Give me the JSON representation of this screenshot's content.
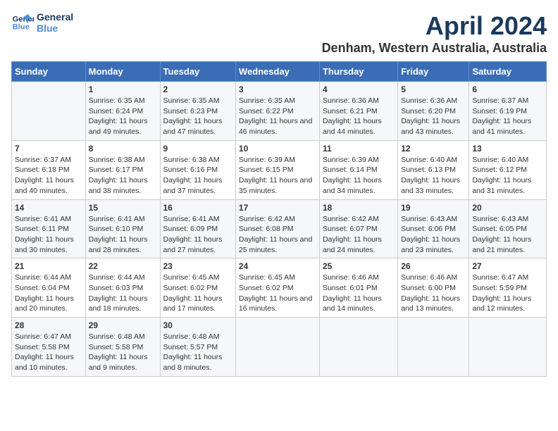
{
  "logo": {
    "line1": "General",
    "line2": "Blue"
  },
  "title": "April 2024",
  "subtitle": "Denham, Western Australia, Australia",
  "columns": [
    "Sunday",
    "Monday",
    "Tuesday",
    "Wednesday",
    "Thursday",
    "Friday",
    "Saturday"
  ],
  "weeks": [
    [
      {
        "day": "",
        "sunrise": "",
        "sunset": "",
        "daylight": ""
      },
      {
        "day": "1",
        "sunrise": "Sunrise: 6:35 AM",
        "sunset": "Sunset: 6:24 PM",
        "daylight": "Daylight: 11 hours and 49 minutes."
      },
      {
        "day": "2",
        "sunrise": "Sunrise: 6:35 AM",
        "sunset": "Sunset: 6:23 PM",
        "daylight": "Daylight: 11 hours and 47 minutes."
      },
      {
        "day": "3",
        "sunrise": "Sunrise: 6:35 AM",
        "sunset": "Sunset: 6:22 PM",
        "daylight": "Daylight: 11 hours and 46 minutes."
      },
      {
        "day": "4",
        "sunrise": "Sunrise: 6:36 AM",
        "sunset": "Sunset: 6:21 PM",
        "daylight": "Daylight: 11 hours and 44 minutes."
      },
      {
        "day": "5",
        "sunrise": "Sunrise: 6:36 AM",
        "sunset": "Sunset: 6:20 PM",
        "daylight": "Daylight: 11 hours and 43 minutes."
      },
      {
        "day": "6",
        "sunrise": "Sunrise: 6:37 AM",
        "sunset": "Sunset: 6:19 PM",
        "daylight": "Daylight: 11 hours and 41 minutes."
      }
    ],
    [
      {
        "day": "7",
        "sunrise": "Sunrise: 6:37 AM",
        "sunset": "Sunset: 6:18 PM",
        "daylight": "Daylight: 11 hours and 40 minutes."
      },
      {
        "day": "8",
        "sunrise": "Sunrise: 6:38 AM",
        "sunset": "Sunset: 6:17 PM",
        "daylight": "Daylight: 11 hours and 38 minutes."
      },
      {
        "day": "9",
        "sunrise": "Sunrise: 6:38 AM",
        "sunset": "Sunset: 6:16 PM",
        "daylight": "Daylight: 11 hours and 37 minutes."
      },
      {
        "day": "10",
        "sunrise": "Sunrise: 6:39 AM",
        "sunset": "Sunset: 6:15 PM",
        "daylight": "Daylight: 11 hours and 35 minutes."
      },
      {
        "day": "11",
        "sunrise": "Sunrise: 6:39 AM",
        "sunset": "Sunset: 6:14 PM",
        "daylight": "Daylight: 11 hours and 34 minutes."
      },
      {
        "day": "12",
        "sunrise": "Sunrise: 6:40 AM",
        "sunset": "Sunset: 6:13 PM",
        "daylight": "Daylight: 11 hours and 33 minutes."
      },
      {
        "day": "13",
        "sunrise": "Sunrise: 6:40 AM",
        "sunset": "Sunset: 6:12 PM",
        "daylight": "Daylight: 11 hours and 31 minutes."
      }
    ],
    [
      {
        "day": "14",
        "sunrise": "Sunrise: 6:41 AM",
        "sunset": "Sunset: 6:11 PM",
        "daylight": "Daylight: 11 hours and 30 minutes."
      },
      {
        "day": "15",
        "sunrise": "Sunrise: 6:41 AM",
        "sunset": "Sunset: 6:10 PM",
        "daylight": "Daylight: 11 hours and 28 minutes."
      },
      {
        "day": "16",
        "sunrise": "Sunrise: 6:41 AM",
        "sunset": "Sunset: 6:09 PM",
        "daylight": "Daylight: 11 hours and 27 minutes."
      },
      {
        "day": "17",
        "sunrise": "Sunrise: 6:42 AM",
        "sunset": "Sunset: 6:08 PM",
        "daylight": "Daylight: 11 hours and 25 minutes."
      },
      {
        "day": "18",
        "sunrise": "Sunrise: 6:42 AM",
        "sunset": "Sunset: 6:07 PM",
        "daylight": "Daylight: 11 hours and 24 minutes."
      },
      {
        "day": "19",
        "sunrise": "Sunrise: 6:43 AM",
        "sunset": "Sunset: 6:06 PM",
        "daylight": "Daylight: 11 hours and 23 minutes."
      },
      {
        "day": "20",
        "sunrise": "Sunrise: 6:43 AM",
        "sunset": "Sunset: 6:05 PM",
        "daylight": "Daylight: 11 hours and 21 minutes."
      }
    ],
    [
      {
        "day": "21",
        "sunrise": "Sunrise: 6:44 AM",
        "sunset": "Sunset: 6:04 PM",
        "daylight": "Daylight: 11 hours and 20 minutes."
      },
      {
        "day": "22",
        "sunrise": "Sunrise: 6:44 AM",
        "sunset": "Sunset: 6:03 PM",
        "daylight": "Daylight: 11 hours and 18 minutes."
      },
      {
        "day": "23",
        "sunrise": "Sunrise: 6:45 AM",
        "sunset": "Sunset: 6:02 PM",
        "daylight": "Daylight: 11 hours and 17 minutes."
      },
      {
        "day": "24",
        "sunrise": "Sunrise: 6:45 AM",
        "sunset": "Sunset: 6:02 PM",
        "daylight": "Daylight: 11 hours and 16 minutes."
      },
      {
        "day": "25",
        "sunrise": "Sunrise: 6:46 AM",
        "sunset": "Sunset: 6:01 PM",
        "daylight": "Daylight: 11 hours and 14 minutes."
      },
      {
        "day": "26",
        "sunrise": "Sunrise: 6:46 AM",
        "sunset": "Sunset: 6:00 PM",
        "daylight": "Daylight: 11 hours and 13 minutes."
      },
      {
        "day": "27",
        "sunrise": "Sunrise: 6:47 AM",
        "sunset": "Sunset: 5:59 PM",
        "daylight": "Daylight: 11 hours and 12 minutes."
      }
    ],
    [
      {
        "day": "28",
        "sunrise": "Sunrise: 6:47 AM",
        "sunset": "Sunset: 5:58 PM",
        "daylight": "Daylight: 11 hours and 10 minutes."
      },
      {
        "day": "29",
        "sunrise": "Sunrise: 6:48 AM",
        "sunset": "Sunset: 5:58 PM",
        "daylight": "Daylight: 11 hours and 9 minutes."
      },
      {
        "day": "30",
        "sunrise": "Sunrise: 6:48 AM",
        "sunset": "Sunset: 5:57 PM",
        "daylight": "Daylight: 11 hours and 8 minutes."
      },
      {
        "day": "",
        "sunrise": "",
        "sunset": "",
        "daylight": ""
      },
      {
        "day": "",
        "sunrise": "",
        "sunset": "",
        "daylight": ""
      },
      {
        "day": "",
        "sunrise": "",
        "sunset": "",
        "daylight": ""
      },
      {
        "day": "",
        "sunrise": "",
        "sunset": "",
        "daylight": ""
      }
    ]
  ]
}
